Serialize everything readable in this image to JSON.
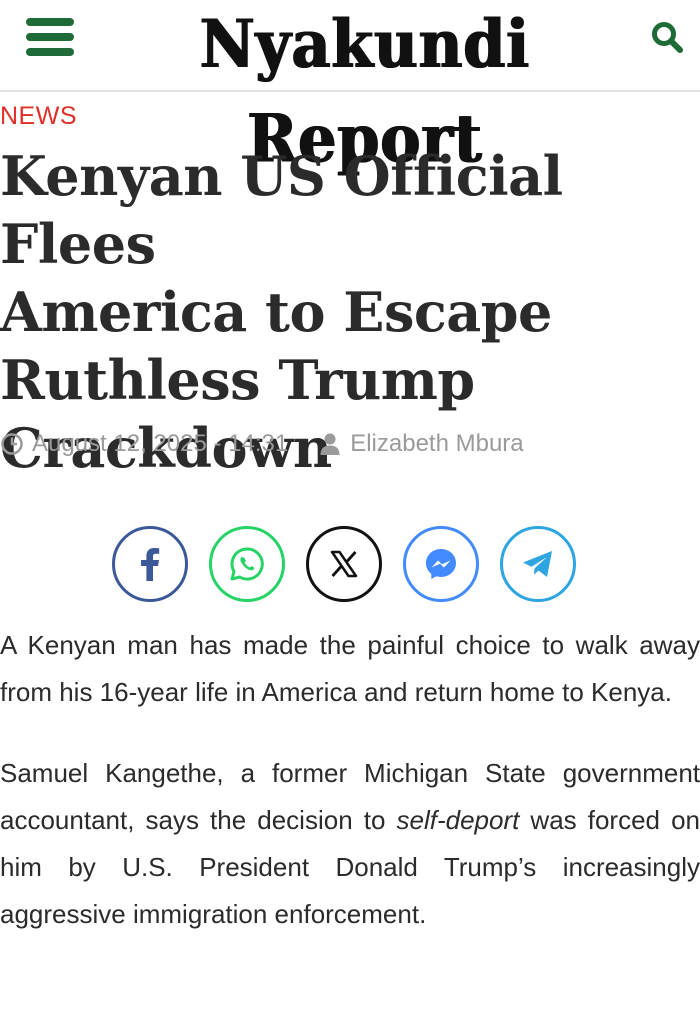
{
  "header": {
    "logo_text": "Nyakundi Report",
    "menu_icon": "hamburger-menu-icon",
    "search_icon": "search-icon",
    "brand_color": "#1f6b38"
  },
  "article": {
    "category": "NEWS",
    "category_color": "#e0302a",
    "headline_lines": [
      "Kenyan US Official Flees",
      "America to Escape",
      "Ruthless Trump",
      "Crackdown"
    ],
    "date": "August 12, 2025 - 14:31",
    "author": "Elizabeth Mbura",
    "paragraph1": "A Kenyan man has made the painful choice to walk away from his 16-year life in America and return home to Kenya.",
    "paragraph2_before": "Samuel Kangethe, a former Michigan State government accountant, says the decision to ",
    "paragraph2_em": "self-deport",
    "paragraph2_after": " was forced on him by U.S. President Donald Trump’s increasingly aggressive immigration enforcement."
  },
  "share": [
    {
      "name": "facebook-share-button",
      "icon": "facebook-icon",
      "color": "#3b5998"
    },
    {
      "name": "whatsapp-share-button",
      "icon": "whatsapp-icon",
      "color": "#25d366"
    },
    {
      "name": "x-share-button",
      "icon": "x-icon",
      "color": "#111111"
    },
    {
      "name": "messenger-share-button",
      "icon": "messenger-icon",
      "color": "#448aff"
    },
    {
      "name": "telegram-share-button",
      "icon": "telegram-icon",
      "color": "#2ca5e0"
    }
  ]
}
